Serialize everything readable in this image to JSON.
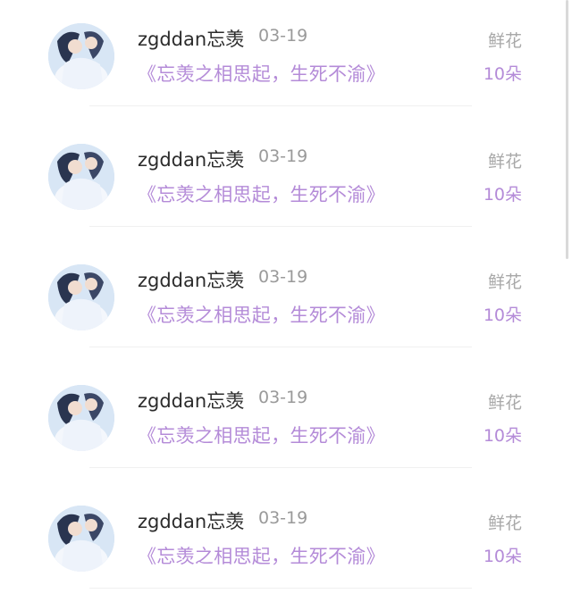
{
  "records": [
    {
      "username": "zgddan忘羡",
      "date": "03-19",
      "message": "《忘羡之相思起，生死不渝》",
      "gift_name": "鲜花",
      "gift_count": "10朵"
    },
    {
      "username": "zgddan忘羡",
      "date": "03-19",
      "message": "《忘羡之相思起，生死不渝》",
      "gift_name": "鲜花",
      "gift_count": "10朵"
    },
    {
      "username": "zgddan忘羡",
      "date": "03-19",
      "message": "《忘羡之相思起，生死不渝》",
      "gift_name": "鲜花",
      "gift_count": "10朵"
    },
    {
      "username": "zgddan忘羡",
      "date": "03-19",
      "message": "《忘羡之相思起，生死不渝》",
      "gift_name": "鲜花",
      "gift_count": "10朵"
    },
    {
      "username": "zgddan忘羡",
      "date": "03-19",
      "message": "《忘羡之相思起，生死不渝》",
      "gift_name": "鲜花",
      "gift_count": "10朵"
    }
  ],
  "colors": {
    "accent_purple": "#b48bd8",
    "username_text": "#2b2b2b",
    "muted_text": "#9a9a9a"
  }
}
